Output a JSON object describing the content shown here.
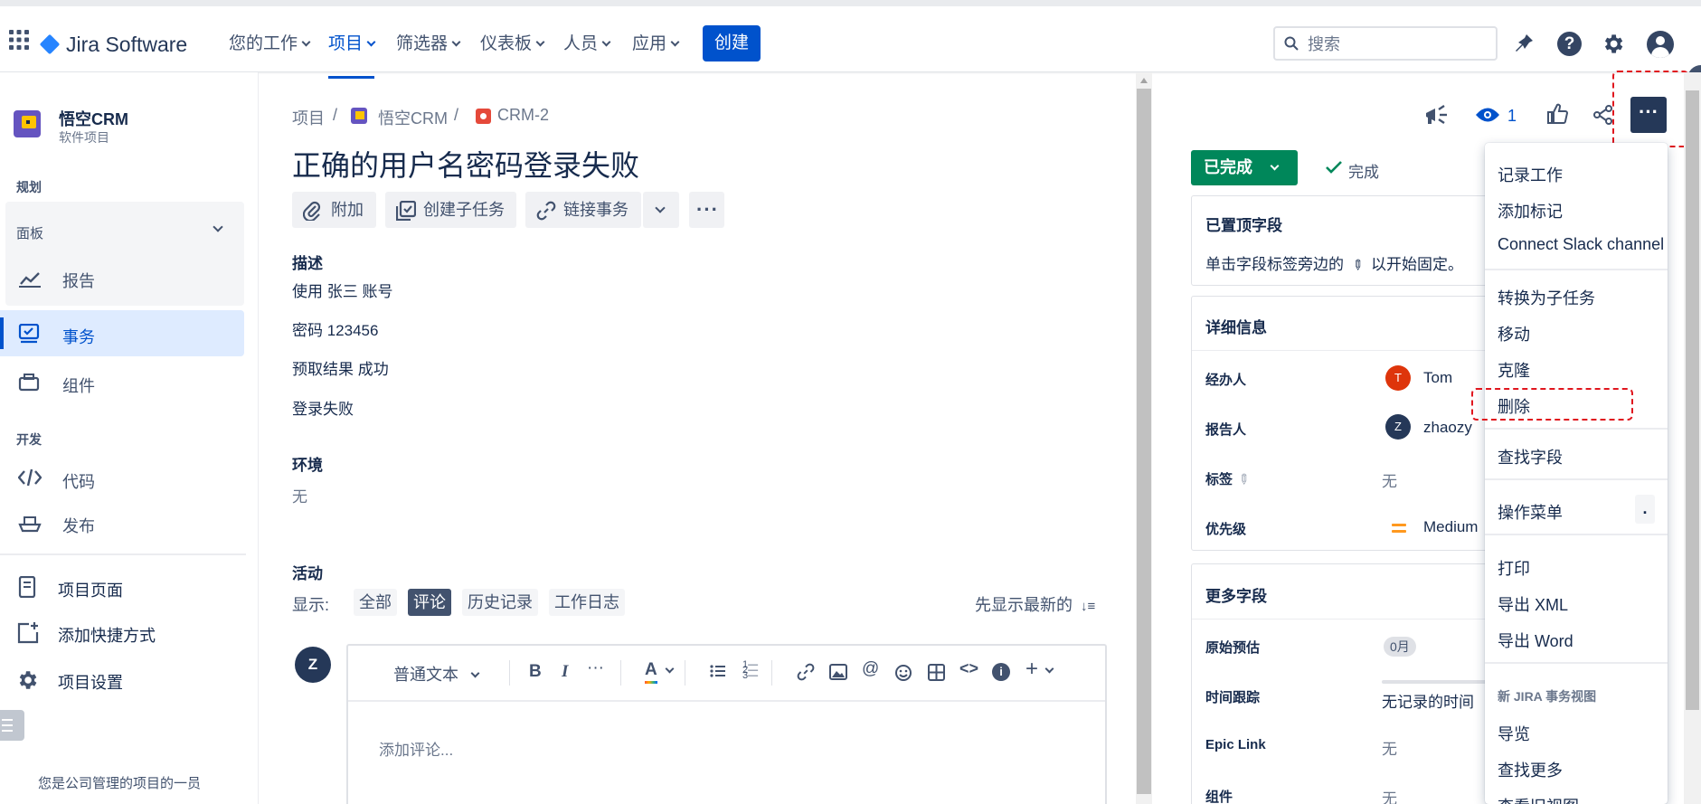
{
  "topnav": {
    "logo": "Jira Software",
    "menus": [
      "您的工作",
      "项目",
      "筛选器",
      "仪表板",
      "人员",
      "应用"
    ],
    "active_menu": "项目",
    "create": "创建",
    "search_placeholder": "搜索"
  },
  "sidebar": {
    "project_name": "悟空CRM",
    "project_type": "软件项目",
    "section_plan": "规划",
    "board": "面板",
    "reports": "报告",
    "issues": "事务",
    "components": "组件",
    "section_dev": "开发",
    "code": "代码",
    "release": "发布",
    "project_pages": "项目页面",
    "add_shortcut": "添加快捷方式",
    "project_settings": "项目设置",
    "footer": "您是公司管理的项目的一员"
  },
  "issue": {
    "breadcrumb": [
      "项目",
      "悟空CRM",
      "CRM-2"
    ],
    "title": "正确的用户名密码登录失败",
    "toolbar": {
      "attach": "附加",
      "subtask": "创建子任务",
      "link": "链接事务"
    },
    "description_label": "描述",
    "description_lines": [
      "使用 张三 账号",
      "密码 123456",
      "预取结果 成功",
      "登录失败"
    ],
    "environment_label": "环境",
    "environment_value": "无",
    "activity_label": "活动",
    "show_label": "显示:",
    "activity_tabs": [
      "全部",
      "评论",
      "历史记录",
      "工作日志"
    ],
    "selected_tab": "评论",
    "sort_label": "先显示最新的",
    "avatar_letter": "Z",
    "editor_style": "普通文本",
    "comment_placeholder": "添加评论..."
  },
  "right_panel": {
    "watch_count": "1",
    "status": "已完成",
    "resolution": "完成",
    "pinned_title": "已置顶字段",
    "pinned_hint": "单击字段标签旁边的",
    "pinned_hint_tail": "以开始固定。",
    "details_title": "详细信息",
    "assignee_label": "经办人",
    "assignee": "Tom",
    "assignee_initial": "T",
    "reporter_label": "报告人",
    "reporter": "zhaozy",
    "reporter_initial": "Z",
    "labels_label": "标签",
    "labels_value": "无",
    "priority_label": "优先级",
    "priority": "Medium",
    "more_title": "更多字段",
    "orig_estimate_label": "原始预估",
    "orig_estimate": "0月",
    "time_tracking_label": "时间跟踪",
    "time_tracking": "无记录的时间",
    "epic_label": "Epic Link",
    "epic_value": "无",
    "component_label": "组件",
    "component_value": "无"
  },
  "more_menu": {
    "items_group1": [
      "记录工作",
      "添加标记",
      "Connect Slack channel"
    ],
    "items_group2": [
      "转换为子任务",
      "移动",
      "克隆",
      "删除"
    ],
    "find_field": "查找字段",
    "actions_menu": "操作菜单",
    "actions_shortcut": ".",
    "items_group3": [
      "打印",
      "导出 XML",
      "导出 Word"
    ],
    "new_view_header": "新 JIRA 事务视图",
    "items_group4": [
      "导览",
      "查找更多",
      "查看旧视图"
    ]
  },
  "colors": {
    "brand": "#0052cc",
    "done_green": "#00875a",
    "assignee_avatar": "#de350b",
    "reporter_avatar": "#253858",
    "priority": "#ff991f",
    "highlight_dash": "#e0161e"
  }
}
